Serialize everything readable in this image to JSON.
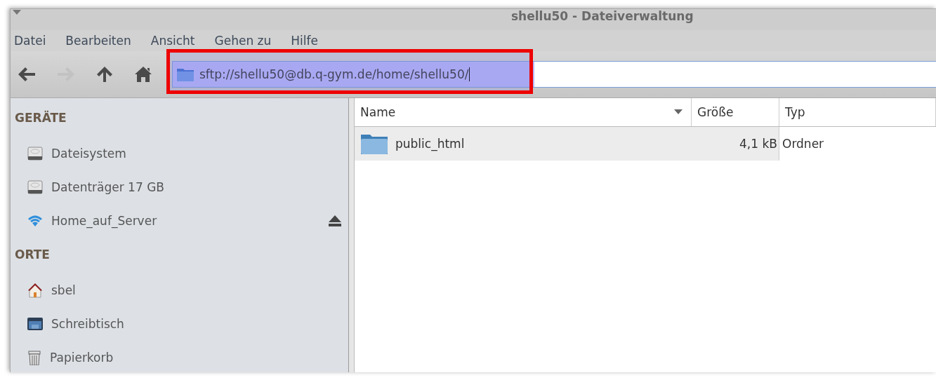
{
  "window": {
    "title": "shellu50 - Dateiverwaltung"
  },
  "menu": [
    "Datei",
    "Bearbeiten",
    "Ansicht",
    "Gehen zu",
    "Hilfe"
  ],
  "toolbar": [
    {
      "kind": "back",
      "disabled": false
    },
    {
      "kind": "forward",
      "disabled": true
    },
    {
      "kind": "up",
      "disabled": false
    },
    {
      "kind": "home",
      "disabled": false
    }
  ],
  "location": {
    "value": "sftp://shellu50@db.q-gym.de/home/shellu50/",
    "highlighted": true
  },
  "sidebar": {
    "sections": [
      {
        "title": "GERÄTE",
        "items": [
          {
            "label": "Dateisystem",
            "kind": "drive",
            "ejectable": false
          },
          {
            "label": "Datenträger 17 GB",
            "kind": "drive",
            "ejectable": false
          },
          {
            "label": "Home_auf_Server",
            "kind": "network",
            "ejectable": true
          }
        ]
      },
      {
        "title": "ORTE",
        "items": [
          {
            "label": "sbel",
            "kind": "home",
            "ejectable": false
          },
          {
            "label": "Schreibtisch",
            "kind": "desktop",
            "ejectable": false
          },
          {
            "label": "Papierkorb",
            "kind": "trash",
            "ejectable": false
          }
        ]
      }
    ]
  },
  "table": {
    "columns": [
      "Name",
      "Größe",
      "Typ"
    ],
    "rows": [
      {
        "name": "public_html",
        "size": "4,1 kB",
        "type": "Ordner",
        "selected": true
      }
    ]
  }
}
